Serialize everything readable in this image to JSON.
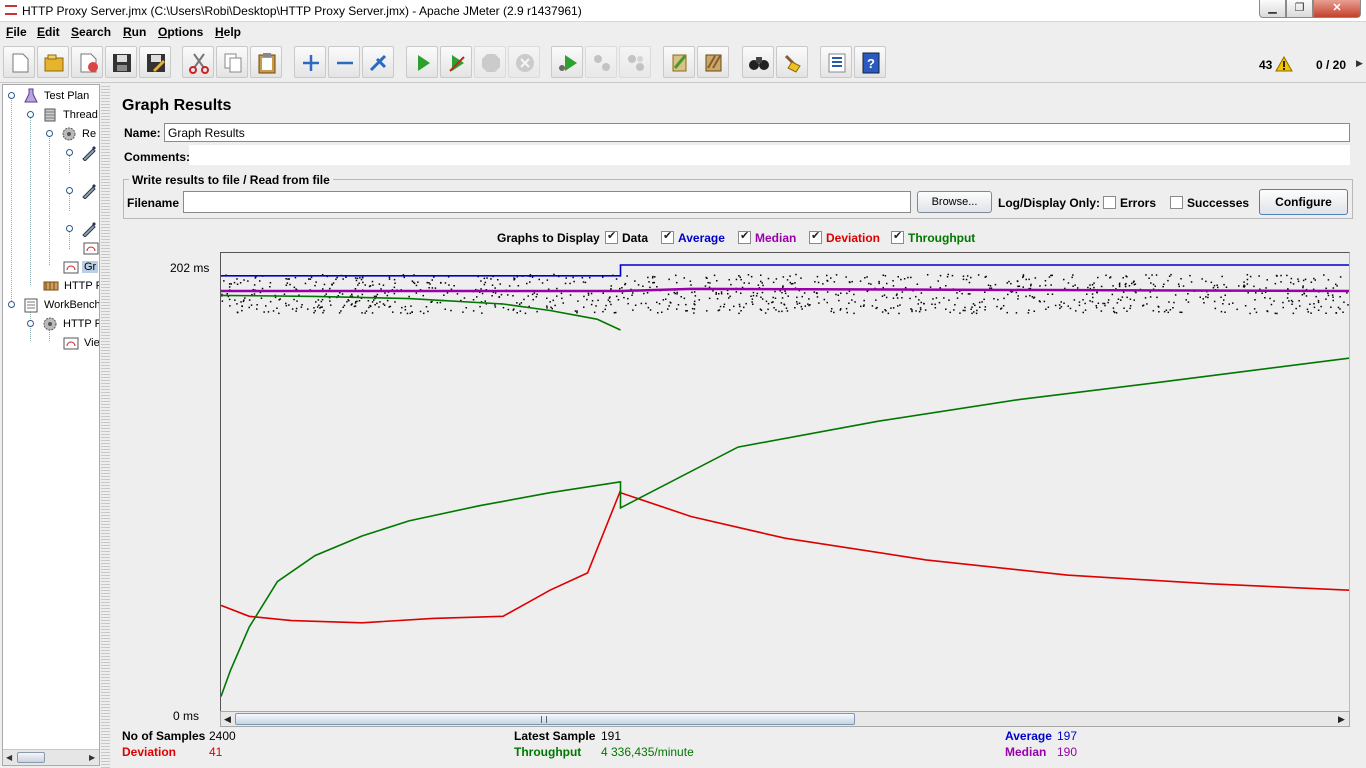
{
  "window": {
    "title": "HTTP Proxy Server.jmx (C:\\Users\\Robi\\Desktop\\HTTP Proxy Server.jmx) - Apache JMeter (2.9 r1437961)",
    "min_glyph": "▁",
    "max_glyph": "❐",
    "close_glyph": "✕"
  },
  "menu": [
    "File",
    "Edit",
    "Search",
    "Run",
    "Options",
    "Help"
  ],
  "toolbar": {
    "buttons": [
      "new-icon",
      "open-icon",
      "close-file-icon",
      "save-icon",
      "save-as-icon",
      "cut-icon",
      "copy-icon",
      "paste-icon",
      "expand-icon",
      "collapse-icon",
      "toggle-icon",
      "start-icon",
      "start-no-timers-icon",
      "stop-icon",
      "shutdown-icon",
      "remote-start-icon",
      "remote-stop-icon",
      "remote-shutdown-icon",
      "clear-icon",
      "clear-all-icon",
      "search-icon",
      "reset-search-icon",
      "function-helper-icon",
      "help-icon"
    ],
    "warning_count": "43",
    "thread_count": "0 / 20"
  },
  "tree": {
    "nodes": [
      "Test Plan",
      "Thread",
      "Re",
      "",
      "",
      "",
      "",
      "Gr",
      "HTTP R",
      "WorkBench",
      "HTTP P",
      "Vie"
    ]
  },
  "panel": {
    "title": "Graph Results",
    "name_label": "Name:",
    "name_value": "Graph Results",
    "comments_label": "Comments:",
    "file_group_title": "Write results to file / Read from file",
    "filename_label": "Filename",
    "browse_label": "Browse...",
    "log_display_label": "Log/Display Only:",
    "errors_label": "Errors",
    "successes_label": "Successes",
    "configure_label": "Configure"
  },
  "graphs_to_display": {
    "label": "Graphs to Display",
    "options": [
      {
        "name": "Data",
        "checked": true,
        "color": "#000000"
      },
      {
        "name": "Average",
        "checked": true,
        "color": "#0000cc"
      },
      {
        "name": "Median",
        "checked": true,
        "color": "#9900aa"
      },
      {
        "name": "Deviation",
        "checked": true,
        "color": "#dd0000"
      },
      {
        "name": "Throughput",
        "checked": true,
        "color": "#007700"
      }
    ]
  },
  "chart_data": {
    "type": "line",
    "y_axis_top": "202 ms",
    "y_axis_bottom": "0 ms",
    "ylim": [
      0,
      202
    ],
    "xlim": [
      0,
      2400
    ],
    "series": [
      {
        "name": "Average",
        "color": "#0000cc",
        "x": [
          0,
          850,
          850,
          2400
        ],
        "y": [
          197,
          197,
          202,
          202
        ]
      },
      {
        "name": "Median",
        "color": "#9900aa",
        "x": [
          0,
          850,
          1000,
          2400
        ],
        "y": [
          190,
          190,
          191,
          190
        ]
      },
      {
        "name": "Deviation",
        "color": "#dd0000",
        "x": [
          0,
          60,
          150,
          300,
          450,
          600,
          650,
          700,
          780,
          850,
          850,
          1000,
          1200,
          1500,
          1800,
          2100,
          2400
        ],
        "y": [
          45,
          40,
          38,
          37,
          39,
          40,
          46,
          52,
          60,
          98,
          97,
          86,
          76,
          66,
          59,
          55,
          52
        ]
      },
      {
        "name": "Throughput",
        "color": "#007700",
        "x": [
          0,
          20,
          60,
          120,
          200,
          300,
          400,
          550,
          700,
          850,
          850,
          1100,
          1400,
          1700,
          2000,
          2400
        ],
        "y": [
          3,
          15,
          35,
          56,
          68,
          77,
          84,
          91,
          97,
          102,
          90,
          118,
          130,
          140,
          148,
          159
        ]
      },
      {
        "name": "Throughput (initial run)",
        "color": "#007700",
        "x": [
          0,
          200,
          400,
          600,
          700,
          800,
          850
        ],
        "y": [
          188,
          187.5,
          186.5,
          184,
          181,
          177,
          172
        ]
      }
    ],
    "data_band_y": [
      180,
      198
    ]
  },
  "stats": {
    "samples_label": "No of Samples",
    "samples_value": "2400",
    "latest_label": "Latest Sample",
    "latest_value": "191",
    "average_label": "Average",
    "average_value": "197",
    "deviation_label": "Deviation",
    "deviation_value": "41",
    "throughput_label": "Throughput",
    "throughput_value": "4 336,435/minute",
    "median_label": "Median",
    "median_value": "190"
  }
}
